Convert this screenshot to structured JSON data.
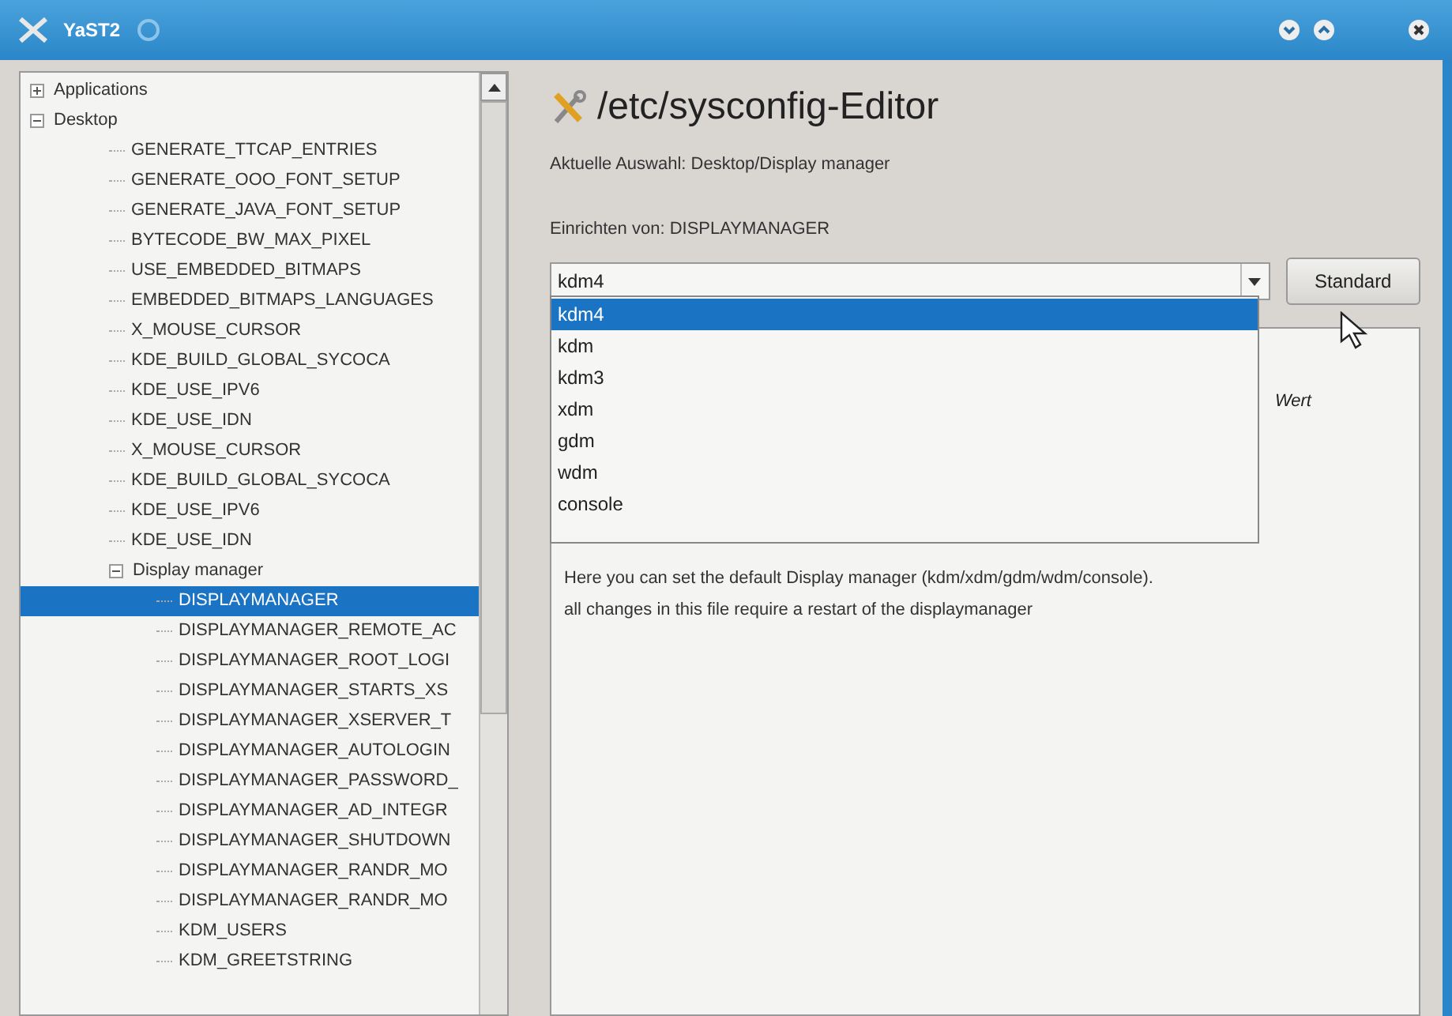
{
  "window": {
    "title": "YaST2"
  },
  "tree": [
    {
      "label": "Applications",
      "expanded": false,
      "selected": false
    },
    {
      "label": "Desktop",
      "expanded": true,
      "selected": false,
      "children": [
        {
          "label": "GENERATE_TTCAP_ENTRIES",
          "selected": false
        },
        {
          "label": "GENERATE_OOO_FONT_SETUP",
          "selected": false
        },
        {
          "label": "GENERATE_JAVA_FONT_SETUP",
          "selected": false
        },
        {
          "label": "BYTECODE_BW_MAX_PIXEL",
          "selected": false
        },
        {
          "label": "USE_EMBEDDED_BITMAPS",
          "selected": false
        },
        {
          "label": "EMBEDDED_BITMAPS_LANGUAGES",
          "selected": false
        },
        {
          "label": "X_MOUSE_CURSOR",
          "selected": false
        },
        {
          "label": "KDE_BUILD_GLOBAL_SYCOCA",
          "selected": false
        },
        {
          "label": "KDE_USE_IPV6",
          "selected": false
        },
        {
          "label": "KDE_USE_IDN",
          "selected": false
        },
        {
          "label": "X_MOUSE_CURSOR",
          "selected": false
        },
        {
          "label": "KDE_BUILD_GLOBAL_SYCOCA",
          "selected": false
        },
        {
          "label": "KDE_USE_IPV6",
          "selected": false
        },
        {
          "label": "KDE_USE_IDN",
          "selected": false
        },
        {
          "label": "Display manager",
          "expanded": true,
          "selected": false,
          "children": [
            {
              "label": "DISPLAYMANAGER",
              "selected": true
            },
            {
              "label": "DISPLAYMANAGER_REMOTE_AC",
              "selected": false
            },
            {
              "label": "DISPLAYMANAGER_ROOT_LOGI",
              "selected": false
            },
            {
              "label": "DISPLAYMANAGER_STARTS_XS",
              "selected": false
            },
            {
              "label": "DISPLAYMANAGER_XSERVER_T",
              "selected": false
            },
            {
              "label": "DISPLAYMANAGER_AUTOLOGIN",
              "selected": false
            },
            {
              "label": "DISPLAYMANAGER_PASSWORD_",
              "selected": false
            },
            {
              "label": "DISPLAYMANAGER_AD_INTEGR",
              "selected": false
            },
            {
              "label": "DISPLAYMANAGER_SHUTDOWN",
              "selected": false
            },
            {
              "label": "DISPLAYMANAGER_RANDR_MO",
              "selected": false
            },
            {
              "label": "DISPLAYMANAGER_RANDR_MO",
              "selected": false
            },
            {
              "label": "KDM_USERS",
              "selected": false
            },
            {
              "label": "KDM_GREETSTRING",
              "selected": false
            }
          ]
        }
      ]
    }
  ],
  "editor": {
    "title": "/etc/sysconfig-Editor",
    "current": "Aktuelle Auswahl: Desktop/Display manager",
    "setup_label": "Einrichten von: DISPLAYMANAGER",
    "combo_value": "kdm4",
    "default_button": "Standard",
    "options": [
      {
        "label": "kdm4",
        "selected": true
      },
      {
        "label": "kdm",
        "selected": false
      },
      {
        "label": "kdm3",
        "selected": false
      },
      {
        "label": "xdm",
        "selected": false
      },
      {
        "label": "gdm",
        "selected": false
      },
      {
        "label": "wdm",
        "selected": false
      },
      {
        "label": "console",
        "selected": false
      }
    ],
    "column_heading": "Wert",
    "description": [
      "Here you can set the default Display manager (kdm/xdm/gdm/wdm/console).",
      "all changes in this file require a restart of the displaymanager"
    ]
  }
}
